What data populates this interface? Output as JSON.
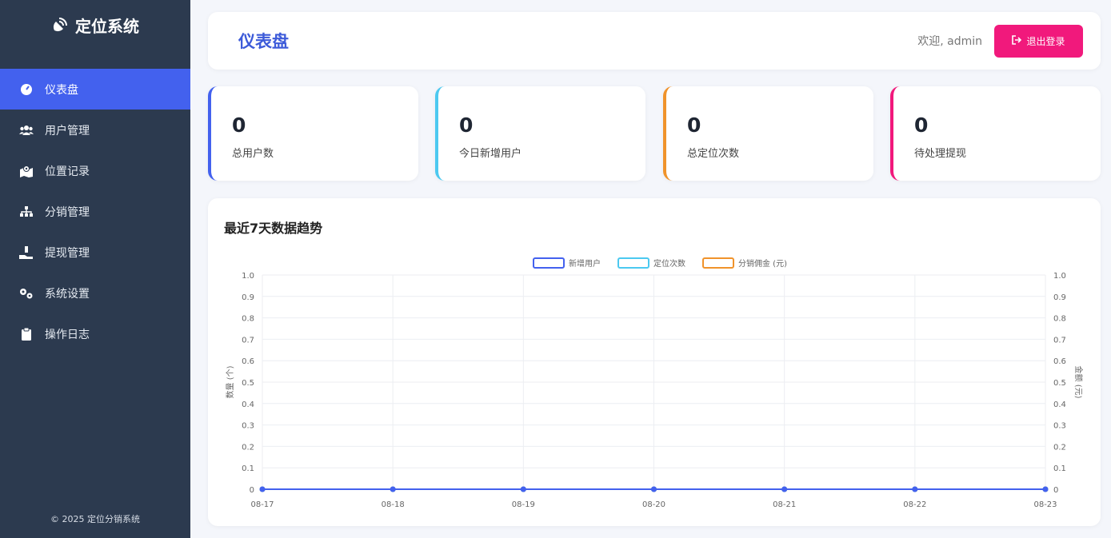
{
  "sidebar": {
    "brand": "定位系统",
    "items": [
      {
        "label": "仪表盘",
        "icon": "dashboard-icon"
      },
      {
        "label": "用户管理",
        "icon": "users-icon"
      },
      {
        "label": "位置记录",
        "icon": "map-location-icon"
      },
      {
        "label": "分销管理",
        "icon": "sitemap-icon"
      },
      {
        "label": "提现管理",
        "icon": "hand-holding-coin-icon"
      },
      {
        "label": "系统设置",
        "icon": "gears-icon"
      },
      {
        "label": "操作日志",
        "icon": "clipboard-icon"
      }
    ],
    "copyright": "© 2025 定位分销系统"
  },
  "header": {
    "title": "仪表盘",
    "welcome": "欢迎, admin",
    "logout_label": "退出登录"
  },
  "stats": [
    {
      "value": "0",
      "label": "总用户数",
      "color": "#4361ee"
    },
    {
      "value": "0",
      "label": "今日新增用户",
      "color": "#4cc9f0"
    },
    {
      "value": "0",
      "label": "总定位次数",
      "color": "#f0932b"
    },
    {
      "value": "0",
      "label": "待处理提现",
      "color": "#f1197c"
    }
  ],
  "chart": {
    "title": "最近7天数据趋势"
  },
  "chart_data": {
    "type": "line",
    "x": [
      "08-17",
      "08-18",
      "08-19",
      "08-20",
      "08-21",
      "08-22",
      "08-23"
    ],
    "series": [
      {
        "name": "新增用户",
        "values": [
          0,
          0,
          0,
          0,
          0,
          0,
          0
        ],
        "color": "#4361ee",
        "axis": "left"
      },
      {
        "name": "定位次数",
        "values": [
          0,
          0,
          0,
          0,
          0,
          0,
          0
        ],
        "color": "#4cc9f0",
        "axis": "left"
      },
      {
        "name": "分销佣金 (元)",
        "values": [
          0,
          0,
          0,
          0,
          0,
          0,
          0
        ],
        "color": "#f0932b",
        "axis": "right"
      }
    ],
    "ylabel_left": "数量 (个)",
    "ylabel_right": "金额 (元)",
    "ylim": [
      0,
      1.0
    ],
    "yticks": [
      "0",
      "0.1",
      "0.2",
      "0.3",
      "0.4",
      "0.5",
      "0.6",
      "0.7",
      "0.8",
      "0.9",
      "1.0"
    ],
    "legend_position": "top-center",
    "grid": true
  }
}
